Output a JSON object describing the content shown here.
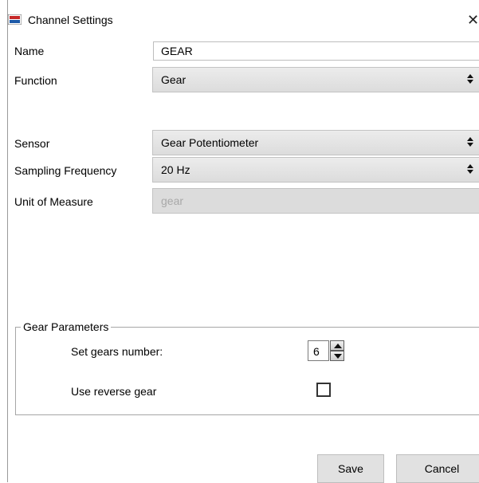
{
  "window": {
    "title": "Channel Settings",
    "close_symbol": "✕"
  },
  "fields": {
    "name": {
      "label": "Name",
      "value": "GEAR"
    },
    "function": {
      "label": "Function",
      "value": "Gear"
    },
    "sensor": {
      "label": "Sensor",
      "value": "Gear Potentiometer"
    },
    "sampling_frequency": {
      "label": "Sampling Frequency",
      "value": "20 Hz"
    },
    "unit_of_measure": {
      "label": "Unit of Measure",
      "value": "gear"
    }
  },
  "gear_parameters": {
    "group_title": "Gear Parameters",
    "gears_number_label": "Set gears number:",
    "gears_number_value": "6",
    "reverse_gear_label": "Use reverse gear",
    "reverse_gear_checked": false
  },
  "buttons": {
    "save": "Save",
    "cancel": "Cancel"
  },
  "icons": {
    "app": "app-logo-icon",
    "close": "close-icon",
    "dropdown": "updown-arrows-icon",
    "spin_up": "spin-up-icon",
    "spin_down": "spin-down-icon"
  }
}
